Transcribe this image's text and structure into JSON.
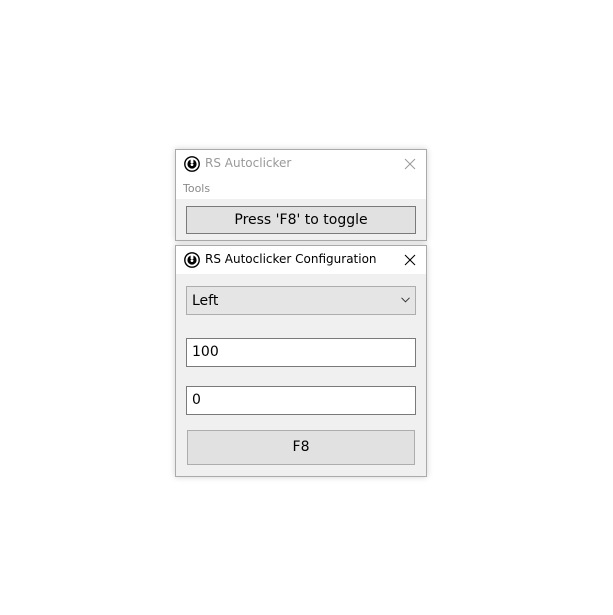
{
  "main_window": {
    "title": "RS Autoclicker",
    "menu": {
      "tools_label": "Tools"
    },
    "toggle_button_label": "Press 'F8' to toggle"
  },
  "config_window": {
    "title": "RS Autoclicker Configuration",
    "click_button_select": {
      "selected": "Left"
    },
    "interval_value": "100",
    "delay_value": "0",
    "hotkey_button_label": "F8"
  },
  "icons": {
    "app": "app-icon",
    "close": "close-icon",
    "dropdown": "chevron-down-icon"
  },
  "colors": {
    "window_bg": "#f0f0f0",
    "titlebar_bg": "#ffffff",
    "button_bg": "#e1e1e1",
    "inactive_title": "#999999"
  }
}
